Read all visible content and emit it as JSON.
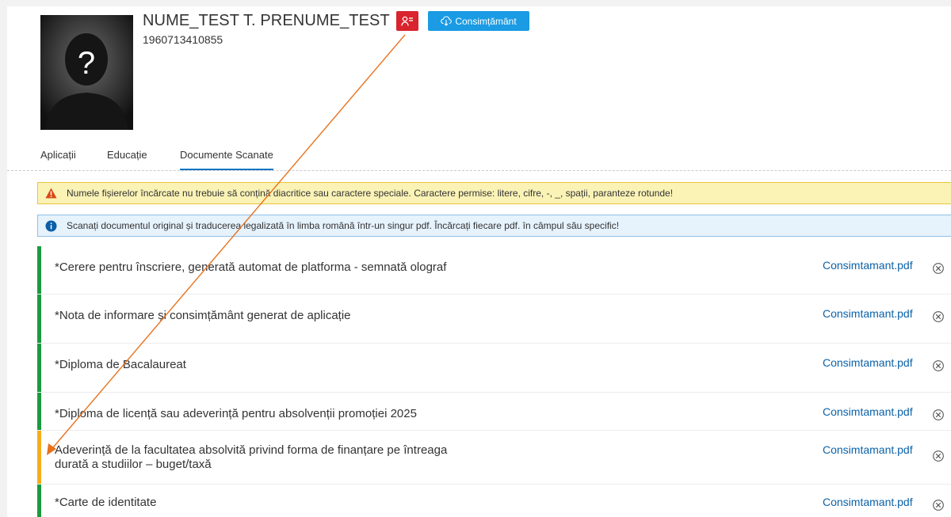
{
  "profile": {
    "name": "NUME_TEST T. PRENUME_TEST",
    "cnp": "1960713410855",
    "photo_placeholder": "?",
    "user_badge_icon": "user-list-icon",
    "consent_button_label": "Consimțământ",
    "consent_button_icon": "cloud-download-icon"
  },
  "tabs": [
    {
      "label": "Aplicații",
      "active": false
    },
    {
      "label": "Educație",
      "active": false
    },
    {
      "label": "Documente Scanate",
      "active": true
    }
  ],
  "alerts": {
    "warning": "Numele fișierelor încărcate nu trebuie să conțină diacritice sau caractere speciale. Caractere permise: litere, cifre, -, _, spații, paranteze rotunde!",
    "info": "Scanați documentul original și traducerea legalizată în limba română într-un singur pdf. Încărcați fiecare pdf. în câmpul său specific!"
  },
  "documents": [
    {
      "label": "*Cerere pentru înscriere, generată automat de platforma - semnată olograf",
      "file": "Consimtamant.pdf",
      "status": "complete"
    },
    {
      "label": "*Nota de informare și consimțământ generat de aplicație",
      "file": "Consimtamant.pdf",
      "status": "complete"
    },
    {
      "label": "*Diploma de Bacalaureat",
      "file": "Consimtamant.pdf",
      "status": "complete"
    },
    {
      "label": "*Diploma de licență sau adeverință pentru absolvenții promoției 2025",
      "file": "Consimtamant.pdf",
      "status": "complete"
    },
    {
      "label": "Adeverință de la facultatea absolvită privind forma de finanțare pe întreaga durată a studiilor – buget/taxă",
      "file": "Consimtamant.pdf",
      "status": "optional"
    },
    {
      "label": "*Carte de identitate",
      "file": "Consimtamant.pdf",
      "status": "complete"
    }
  ],
  "colors": {
    "complete": "#1a9a3e",
    "optional": "#f3ad1d",
    "badge_red": "#d9232d",
    "button_blue": "#1a9be3",
    "link_blue": "#0a62a8",
    "annotation": "#e8711d"
  }
}
